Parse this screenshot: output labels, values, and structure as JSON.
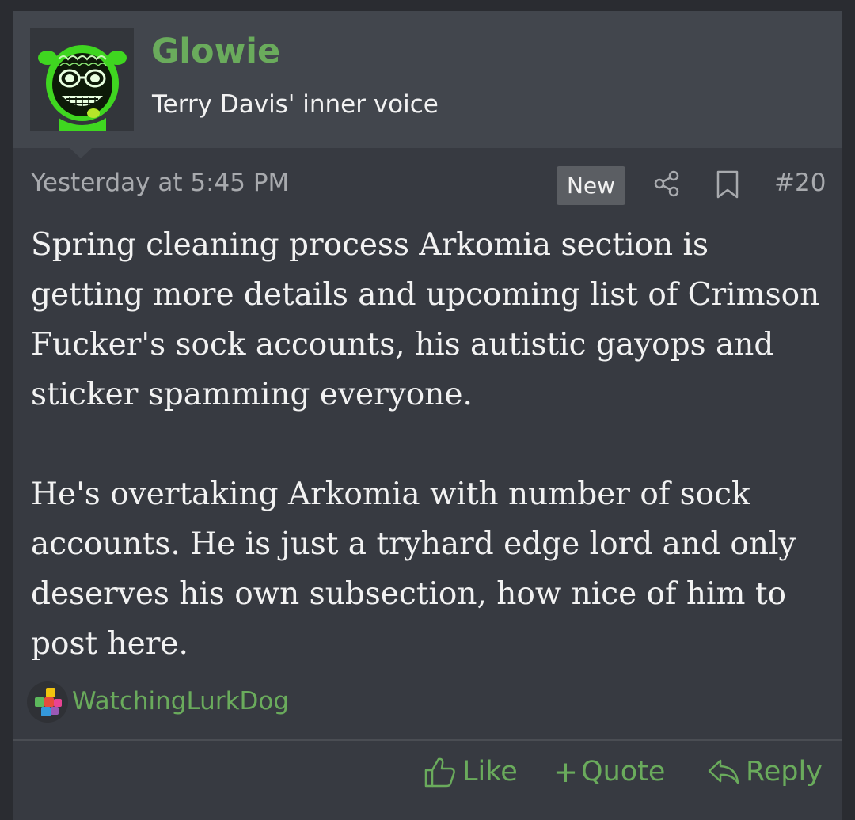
{
  "user": {
    "name": "Glowie",
    "title": "Terry Davis' inner voice",
    "avatar": "glowing-green-creature-avatar"
  },
  "meta": {
    "date": "Yesterday at 5:45 PM",
    "badge": "New",
    "share_icon": "share-icon",
    "bookmark_icon": "bookmark-icon",
    "post_number": "#20"
  },
  "body": {
    "paragraph_1": "Spring cleaning process Arkomia section is getting more details and upcoming list of Crimson Fucker's sock accounts, his autistic gayops and sticker spamming everyone.",
    "paragraph_2": "He's overtaking Arkomia with number of sock accounts. He is just a tryhard edge lord and only deserves his own subsection, how nice of him to post here."
  },
  "reactions": {
    "icon": "puzzle-pieces-reaction-icon",
    "users": "WatchingLurkDog"
  },
  "actions": {
    "like": "Like",
    "quote": "Quote",
    "reply": "Reply"
  },
  "colors": {
    "accent": "#6aab5c",
    "background": "#373a41",
    "header": "#42464d",
    "text": "#f2f2f2",
    "muted": "#a8aaae"
  }
}
